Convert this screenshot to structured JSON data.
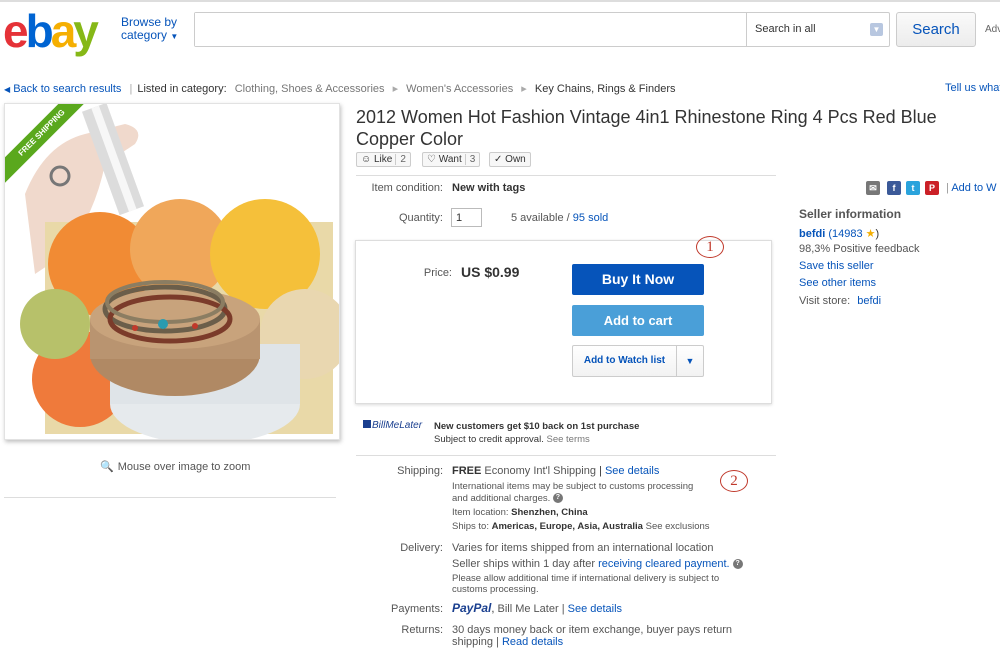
{
  "header": {
    "logo": [
      "e",
      "b",
      "a",
      "y"
    ],
    "browse_label": "Browse by",
    "category_label": "category",
    "search_placeholder": "",
    "search_scope": "Search in all",
    "search_button": "Search",
    "advanced_label": "Adv"
  },
  "breadcrumb": {
    "back": "Back to search results",
    "listed_in": "Listed in category:",
    "items": [
      "Clothing, Shoes & Accessories",
      "Women's Accessories",
      "Key Chains, Rings & Finders"
    ],
    "tell_us": "Tell us what"
  },
  "image": {
    "ribbon": "FREE SHIPPING",
    "zoom_hint": "Mouse over image to zoom"
  },
  "item": {
    "title": "2012 Women Hot Fashion Vintage 4in1 Rhinestone Ring 4 Pcs Red Blue Copper Color",
    "social": [
      {
        "label": "Like",
        "count": "2",
        "icon": "smiley-icon"
      },
      {
        "label": "Want",
        "count": "3",
        "icon": "heart-icon"
      },
      {
        "label": "Own",
        "count": "",
        "icon": "check-circle-icon"
      }
    ],
    "condition_label": "Item condition:",
    "condition_value": "New with tags",
    "quantity_label": "Quantity:",
    "quantity_value": "1",
    "available_text": "5 available /",
    "sold_text": "95 sold",
    "price_label": "Price:",
    "price_value": "US $0.99",
    "buy_now": "Buy It Now",
    "add_to_cart": "Add to cart",
    "add_to_watch": "Add to Watch list",
    "annotation_1": "1",
    "annotation_2": "2"
  },
  "billmelater": {
    "logo": "BillMeLater",
    "headline": "New customers get $10 back on 1st purchase",
    "sub": "Subject to credit approval.",
    "terms": "See terms"
  },
  "shipping": {
    "label": "Shipping:",
    "free": "FREE",
    "method": "Economy Int'l Shipping",
    "see_details": "See details",
    "intl_line1": "International items may be subject to customs processing",
    "intl_line2": "and additional charges.",
    "location_label": "Item location:",
    "location_value": "Shenzhen, China",
    "ships_to_label": "Ships to:",
    "ships_to_value": "Americas, Europe, Asia, Australia",
    "exclusions": "See exclusions"
  },
  "delivery": {
    "label": "Delivery:",
    "line1": "Varies for items shipped from an international location",
    "line2a": "Seller ships within 1 day after",
    "line2b": "receiving cleared payment.",
    "line3": "Please allow additional time if international delivery is subject to",
    "line4": "customs processing."
  },
  "payments": {
    "label": "Payments:",
    "paypal": "PayPal",
    "other": "Bill Me Later |",
    "see_details": "See details"
  },
  "returns": {
    "label": "Returns:",
    "line1": "30 days money back or item exchange, buyer pays return",
    "line2": "shipping |",
    "read_details": "Read details"
  },
  "share": {
    "add_to": "Add to W"
  },
  "seller": {
    "heading": "Seller information",
    "name": "befdi",
    "score": "(14983",
    "score_close": ")",
    "feedback": "98,3% Positive feedback",
    "save": "Save this seller",
    "other_items": "See other items",
    "visit_label": "Visit store:",
    "store": "befdi"
  },
  "colors": {
    "ebay_red": "#e53238",
    "ebay_blue": "#0064d2",
    "ebay_yellow": "#f5af02",
    "ebay_green": "#86b817",
    "link": "#0654ba",
    "buy_button": "#0654ba",
    "cart_button": "#4a9fd8"
  }
}
